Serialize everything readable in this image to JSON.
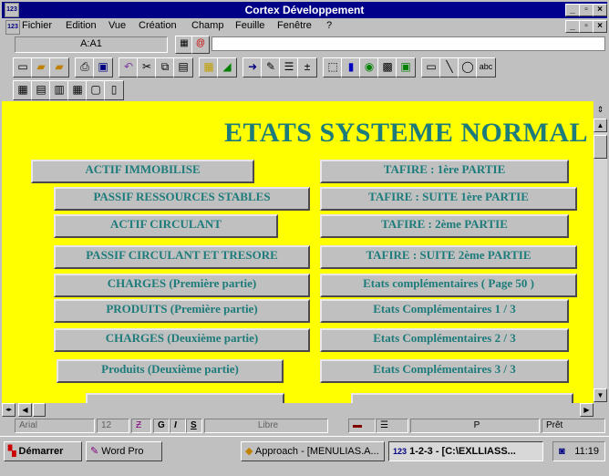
{
  "window": {
    "title": "Cortex Développement",
    "app_icon_label": "123",
    "controls": [
      "_",
      "▫",
      "×"
    ]
  },
  "menu": {
    "items": [
      "Fichier",
      "Edition",
      "Vue",
      "Création",
      "Champ",
      "Feuille",
      "Fenêtre",
      "?"
    ]
  },
  "address": {
    "cell": "A:A1"
  },
  "toolbar": {
    "icons1": [
      "new-icon",
      "open-icon",
      "folder-icon",
      "print-icon",
      "preview-icon",
      "undo-icon",
      "cut-icon",
      "copy-icon",
      "paste-icon",
      "chart-icon",
      "draw-icon",
      "arrow-icon",
      "brush-icon",
      "sort-icon",
      "sum-icon",
      "select-icon",
      "barchart-icon",
      "globe-icon",
      "map-icon",
      "rect-icon",
      "line-icon",
      "ellipse-icon",
      "text-icon"
    ],
    "icons2": [
      "grid-icon",
      "sheet-icon",
      "sheets-icon",
      "table-icon",
      "frame-icon",
      "page-icon"
    ]
  },
  "content": {
    "heading": "ETATS SYSTEME NORMAL",
    "left_buttons": [
      "ACTIF IMMOBILISE",
      "PASSIF RESSOURCES STABLES",
      "ACTIF CIRCULANT",
      "PASSIF CIRCULANT ET TRESORE",
      "CHARGES (Première partie)",
      "PRODUITS (Première partie)",
      "CHARGES (Deuxième partie)",
      "Produits (Deuxième partie)"
    ],
    "right_buttons": [
      "TAFIRE : 1ère PARTIE",
      "TAFIRE : SUITE 1ère PARTIE",
      "TAFIRE : 2ème PARTIE",
      "TAFIRE : SUITE 2ème PARTIE",
      "Etats complémentaires ( Page 50 )",
      "Etats Complémentaires 1 / 3",
      "Etats Complémentaires 2 / 3",
      "Etats Complémentaires 3 / 3"
    ],
    "accent_color": "#1e7b7b",
    "background_color": "#ffff00"
  },
  "status": {
    "font": "Arial",
    "size": "12",
    "bold": "G",
    "italic": "I",
    "underline": "S",
    "style": "Libre",
    "mode_p": "P",
    "ready": "Prêt"
  },
  "taskbar": {
    "start": "Démarrer",
    "tasks": [
      "Word Pro",
      "Approach - [MENULIAS.A...",
      "1-2-3 - [C:\\EXLLIASS..."
    ],
    "clock": "11:19"
  }
}
